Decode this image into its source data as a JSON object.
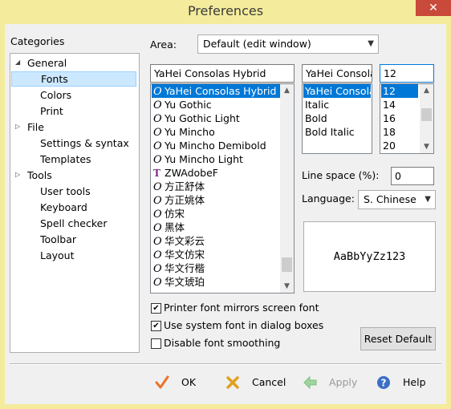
{
  "window": {
    "title": "Preferences",
    "close_glyph": "✕"
  },
  "categories": {
    "label": "Categories",
    "tree": [
      {
        "label": "General",
        "expanded": true,
        "level": 0
      },
      {
        "label": "Fonts",
        "level": 1,
        "selected": true
      },
      {
        "label": "Colors",
        "level": 1
      },
      {
        "label": "Print",
        "level": 1
      },
      {
        "label": "File",
        "expanded": false,
        "level": 0
      },
      {
        "label": "Settings & syntax",
        "level": 1
      },
      {
        "label": "Templates",
        "level": 1
      },
      {
        "label": "Tools",
        "expanded": false,
        "level": 0
      },
      {
        "label": "User tools",
        "level": 1
      },
      {
        "label": "Keyboard",
        "level": 1
      },
      {
        "label": "Spell checker",
        "level": 1
      },
      {
        "label": "Toolbar",
        "level": 1
      },
      {
        "label": "Layout",
        "level": 1
      }
    ]
  },
  "area": {
    "label": "Area:",
    "value": "Default (edit window)"
  },
  "font_name": {
    "value": "YaHei Consolas Hybrid",
    "list": [
      {
        "name": "YaHei Consolas Hybrid",
        "icon": "opentype-icon",
        "selected": true
      },
      {
        "name": "Yu Gothic",
        "icon": "opentype-icon"
      },
      {
        "name": "Yu Gothic Light",
        "icon": "opentype-icon"
      },
      {
        "name": "Yu Mincho",
        "icon": "opentype-icon"
      },
      {
        "name": "Yu Mincho Demibold",
        "icon": "opentype-icon"
      },
      {
        "name": "Yu Mincho Light",
        "icon": "opentype-icon"
      },
      {
        "name": "ZWAdobeF",
        "icon": "truetype-icon"
      },
      {
        "name": "方正舒体",
        "icon": "opentype-icon"
      },
      {
        "name": "方正姚体",
        "icon": "opentype-icon"
      },
      {
        "name": "仿宋",
        "icon": "opentype-icon"
      },
      {
        "name": "黑体",
        "icon": "opentype-icon"
      },
      {
        "name": "华文彩云",
        "icon": "opentype-icon"
      },
      {
        "name": "华文仿宋",
        "icon": "opentype-icon"
      },
      {
        "name": "华文行楷",
        "icon": "opentype-icon"
      },
      {
        "name": "华文琥珀",
        "icon": "opentype-icon"
      }
    ]
  },
  "font_style": {
    "value": "YaHei Consola",
    "list": [
      {
        "name": "YaHei Consola",
        "selected": true
      },
      {
        "name": "Italic"
      },
      {
        "name": "Bold"
      },
      {
        "name": "Bold Italic"
      }
    ]
  },
  "font_size": {
    "value": "12",
    "list": [
      {
        "name": "12",
        "selected": true
      },
      {
        "name": "14"
      },
      {
        "name": "16"
      },
      {
        "name": "18"
      },
      {
        "name": "20"
      }
    ]
  },
  "line_space": {
    "label": "Line space (%):",
    "value": "0"
  },
  "language": {
    "label": "Language:",
    "value": "S. Chinese"
  },
  "preview": {
    "sample": "AaBbYyZz123"
  },
  "options": [
    {
      "label": "Printer font mirrors screen font",
      "checked": true
    },
    {
      "label": "Use system font in dialog boxes",
      "checked": true
    },
    {
      "label": "Disable font smoothing",
      "checked": false
    }
  ],
  "reset_button": {
    "label": "Reset Default"
  },
  "dialog_buttons": {
    "ok": "OK",
    "cancel": "Cancel",
    "apply": "Apply",
    "help": "Help"
  },
  "colors": {
    "accent": "#0078d7",
    "ok_check": "#e8742a",
    "cancel_x": "#e0a020",
    "apply_arrow": "#9fd49f",
    "help_icon": "#3b6fc4"
  }
}
